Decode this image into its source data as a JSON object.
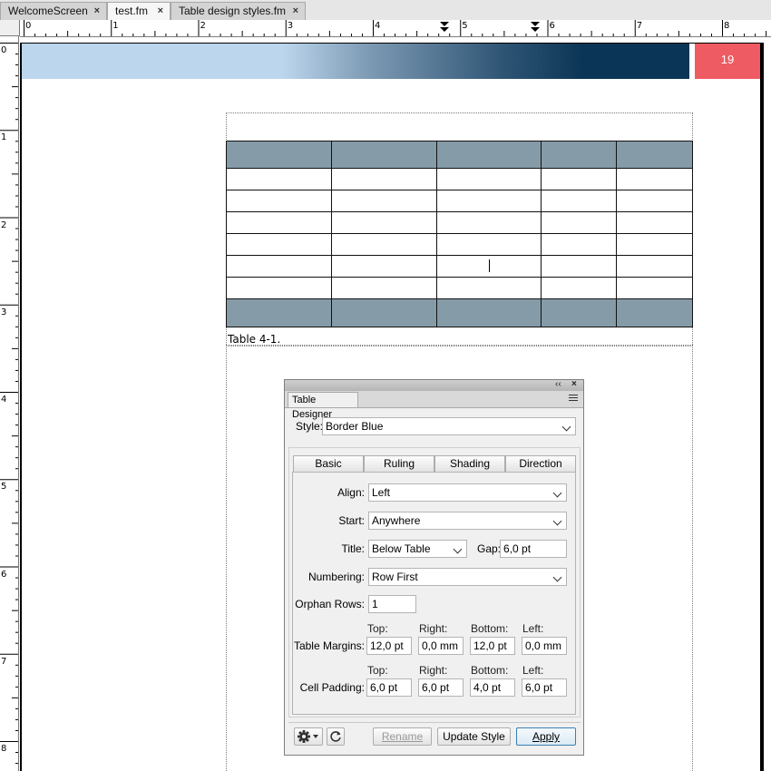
{
  "tabs": [
    {
      "label": "WelcomeScreen",
      "close": "×",
      "active": false
    },
    {
      "label": "test.fm",
      "close": "×",
      "active": true
    },
    {
      "label": "Table design styles.fm",
      "close": "×",
      "active": false
    }
  ],
  "ruler": {
    "horizontal": [
      "0",
      "1",
      "2",
      "3",
      "4",
      "5",
      "6",
      "7",
      "8"
    ],
    "vertical": [
      "0",
      "1",
      "2",
      "3",
      "4",
      "5",
      "6",
      "7",
      "8"
    ]
  },
  "page": {
    "page_number": "19",
    "caption": "Table 4-1.",
    "table": {
      "header_rows": 1,
      "body_rows": 6,
      "footer_rows": 1,
      "columns": 5
    }
  },
  "panel": {
    "tab_label": "Table Designer",
    "collapse_glyph": "‹‹",
    "close_glyph": "×",
    "style_label": "Style:",
    "style_value": "Border Blue",
    "tabs": [
      "Basic",
      "Ruling",
      "Shading",
      "Direction"
    ],
    "align_label": "Align:",
    "align_value": "Left",
    "start_label": "Start:",
    "start_value": "Anywhere",
    "title_label": "Title:",
    "title_value": "Below Table",
    "gap_label": "Gap:",
    "gap_value": "6,0 pt",
    "numbering_label": "Numbering:",
    "numbering_value": "Row First",
    "orphan_label": "Orphan Rows:",
    "orphan_value": "1",
    "side_labels": {
      "top": "Top:",
      "right": "Right:",
      "bottom": "Bottom:",
      "left": "Left:"
    },
    "margins_label": "Table Margins:",
    "margins": {
      "top": "12,0 pt",
      "right": "0,0 mm",
      "bottom": "12,0 pt",
      "left": "0,0 mm"
    },
    "padding_label": "Cell Padding:",
    "padding": {
      "top": "6,0 pt",
      "right": "6,0 pt",
      "bottom": "4,0 pt",
      "left": "6,0 pt"
    },
    "buttons": {
      "rename": "Rename",
      "update": "Update Style",
      "apply": "Apply"
    }
  }
}
